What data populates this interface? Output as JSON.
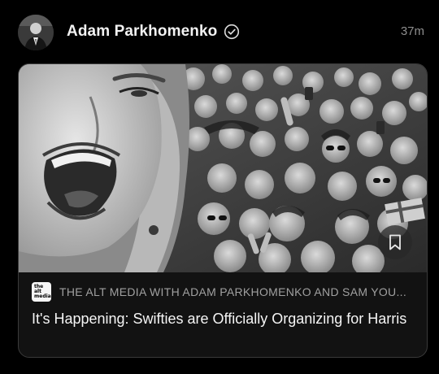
{
  "post": {
    "author_name": "Adam Parkhomenko",
    "timestamp": "37m",
    "avatar_icon": "person-avatar-icon",
    "verified_icon": "verified-check-icon"
  },
  "link_card": {
    "source_logo_lines": [
      "the",
      "alt",
      "media"
    ],
    "source_name": "THE ALT MEDIA WITH ADAM PARKHOMENKO AND SAM YOU...",
    "title": "It's Happening: Swifties are Officially Organizing for Harris",
    "bookmark_icon": "bookmark-icon",
    "image_description_icon": "crowd-selfie-photo"
  }
}
